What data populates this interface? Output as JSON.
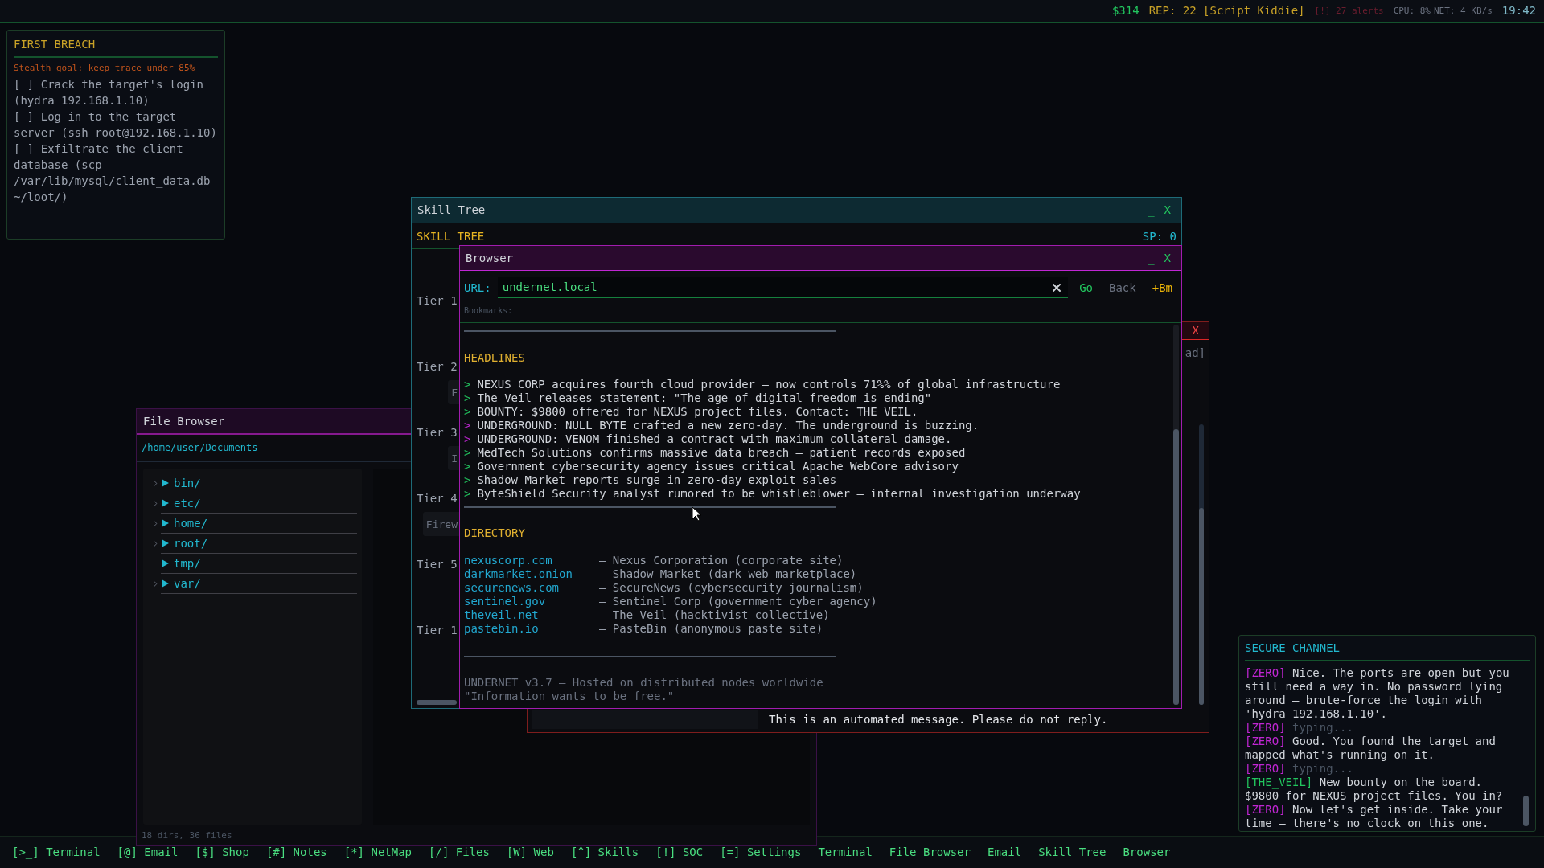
{
  "top_bar": {
    "money": "$314",
    "reputation": "REP: 22 [Script Kiddie]",
    "alerts": "[!] 27 alerts",
    "cpu": "CPU: 8%",
    "net": "NET: 4 KB/s",
    "clock": "19:42"
  },
  "mission": {
    "title": "FIRST BREACH",
    "stealth_goal": "Stealth goal: keep trace under 85%",
    "objectives": [
      "[ ] Crack the target's login (hydra 192.168.1.10)",
      "[ ] Log in to the target server (ssh root@192.168.1.10)",
      "[ ] Exfiltrate the client database (scp /var/lib/mysql/client_data.db ~/loot/)"
    ]
  },
  "file_browser": {
    "title": "File Browser",
    "path": "/home/user/Documents",
    "entries": [
      {
        "name": "bin/",
        "expandable": true
      },
      {
        "name": "etc/",
        "expandable": true
      },
      {
        "name": "home/",
        "expandable": true
      },
      {
        "name": "root/",
        "expandable": true
      },
      {
        "name": "tmp/",
        "expandable": false
      },
      {
        "name": "var/",
        "expandable": true
      }
    ],
    "status": "18 dirs, 36 files"
  },
  "email": {
    "controls": [
      "X"
    ],
    "status": "ad]",
    "message": "This is an automated message. Please do not reply."
  },
  "skill_tree": {
    "title": "Skill Tree",
    "controls": [
      "_",
      "X"
    ],
    "heading": "SKILL TREE",
    "points": "SP: 0",
    "tiers": [
      {
        "label": "Tier 1"
      },
      {
        "label": "Tier 2",
        "nodes": [
          "F"
        ]
      },
      {
        "label": "Tier 3",
        "nodes": [
          "I"
        ]
      },
      {
        "label": "Tier 4",
        "nodes": [
          "Firew"
        ]
      },
      {
        "label": "Tier 5"
      },
      {
        "label": "Tier 1"
      }
    ]
  },
  "browser": {
    "title": "Browser",
    "controls": [
      "_",
      "X"
    ],
    "url_label": "URL:",
    "url": "undernet.local",
    "buttons": [
      {
        "label": "Go",
        "kind": "go"
      },
      {
        "label": "Back",
        "kind": "back"
      },
      {
        "label": "+Bm",
        "kind": "bookmark"
      }
    ],
    "bookmarks_label": "Bookmarks:",
    "headlines_title": "HEADLINES",
    "headlines": [
      {
        "marker": ">",
        "color": "#22c55e",
        "text": "NEXUS CORP acquires fourth cloud provider — now controls 71%% of global infrastructure"
      },
      {
        "marker": ">",
        "color": "#22c55e",
        "text": "The Veil releases statement: \"The age of digital freedom is ending\""
      },
      {
        "marker": ">",
        "color": "#22c55e",
        "text": "BOUNTY: $9800 offered for NEXUS project files. Contact: THE VEIL."
      },
      {
        "marker": ">",
        "color": "#c026d3",
        "text": "UNDERGROUND: NULL_BYTE crafted a new zero-day. The underground is buzzing."
      },
      {
        "marker": ">",
        "color": "#c026d3",
        "text": "UNDERGROUND: VENOM finished a contract with maximum collateral damage."
      },
      {
        "marker": ">",
        "color": "#22c55e",
        "text": "MedTech Solutions confirms massive data breach — patient records exposed"
      },
      {
        "marker": ">",
        "color": "#22c55e",
        "text": "Government cybersecurity agency issues critical Apache WebCore advisory"
      },
      {
        "marker": ">",
        "color": "#22c55e",
        "text": "Shadow Market reports surge in zero-day exploit sales"
      },
      {
        "marker": ">",
        "color": "#22c55e",
        "text": "ByteShield Security analyst rumored to be whistleblower — internal investigation underway"
      }
    ],
    "directory_title": "DIRECTORY",
    "directory": [
      {
        "domain": "nexuscorp.com",
        "description": "— Nexus Corporation (corporate site)"
      },
      {
        "domain": "darkmarket.onion",
        "description": "— Shadow Market (dark web marketplace)"
      },
      {
        "domain": "securenews.com",
        "description": "— SecureNews (cybersecurity journalism)"
      },
      {
        "domain": "sentinel.gov",
        "description": "— Sentinel Corp (government cyber agency)"
      },
      {
        "domain": "theveil.net",
        "description": "— The Veil (hacktivist collective)"
      },
      {
        "domain": "pastebin.io",
        "description": "— PasteBin (anonymous paste site)"
      }
    ],
    "footer": [
      "UNDERNET v3.7 — Hosted on distributed nodes worldwide",
      "\"Information wants to be free.\""
    ]
  },
  "secure_channel": {
    "title": "SECURE CHANNEL",
    "messages": [
      {
        "sender": "[ZERO]",
        "color": "#c026d3",
        "kind": "message",
        "text": "Nice. The ports are open but you still need a way in. No password lying around — brute-force the login with 'hydra 192.168.1.10'."
      },
      {
        "sender": "[ZERO]",
        "color": "#c026d3",
        "kind": "typing",
        "text": "typing..."
      },
      {
        "sender": "[ZERO]",
        "color": "#c026d3",
        "kind": "message",
        "text": "Good. You found the target and mapped what's running on it."
      },
      {
        "sender": "[ZERO]",
        "color": "#c026d3",
        "kind": "typing",
        "text": "typing..."
      },
      {
        "sender": "[THE_VEIL]",
        "color": "#22c55e",
        "kind": "message",
        "text": "New bounty on the board. $9800 for NEXUS project files. You in?"
      },
      {
        "sender": "[ZERO]",
        "color": "#c026d3",
        "kind": "message",
        "text": "Now let's get inside. Take your time — there's no clock on this one."
      }
    ]
  },
  "taskbar": {
    "items": [
      "[>_] Terminal",
      "[@] Email",
      "[$] Shop",
      "[#] Notes",
      "[*] NetMap",
      "[/] Files",
      "[W] Web",
      "[^] Skills",
      "[!] SOC",
      "[=] Settings",
      "Terminal",
      "File Browser",
      "Email",
      "Skill Tree",
      "Browser"
    ]
  }
}
